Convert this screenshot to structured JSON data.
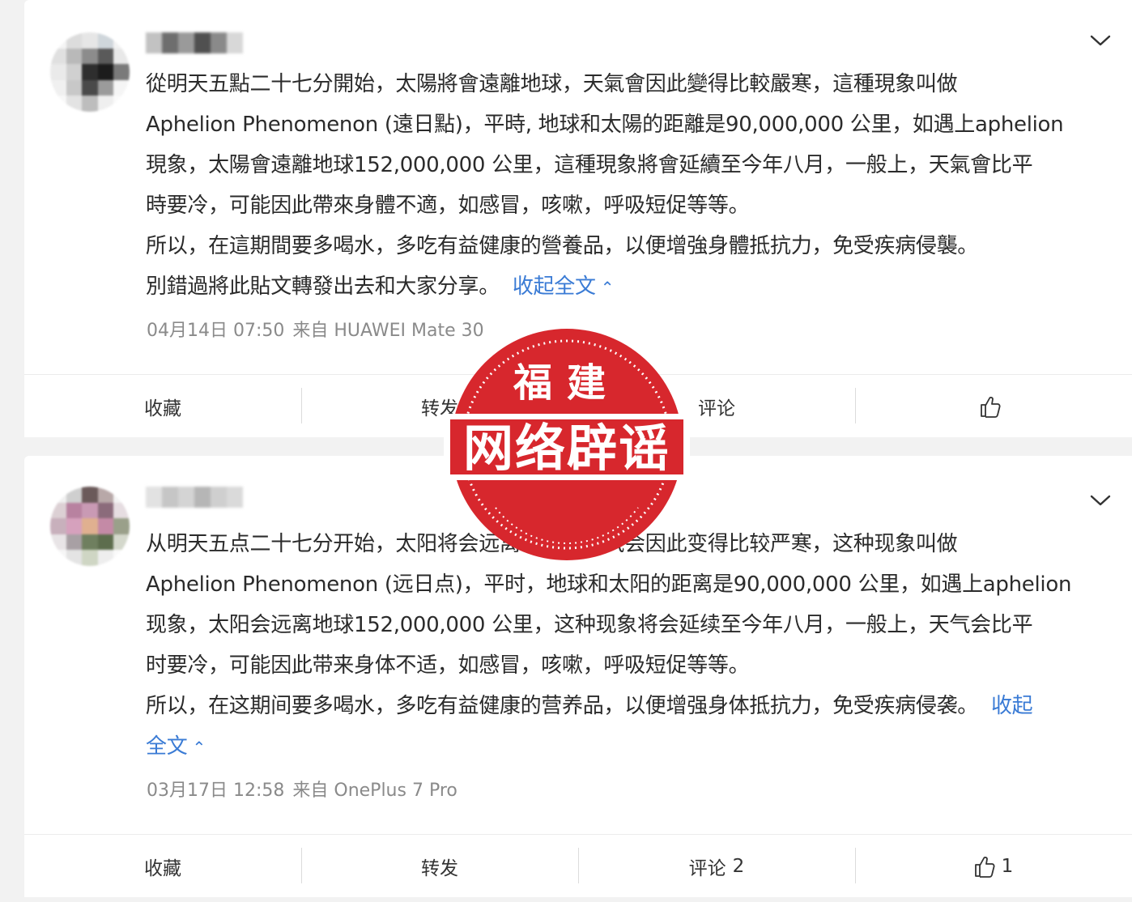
{
  "posts": [
    {
      "lines": [
        "從明天五點二十七分開始，太陽將會遠離地球，天氣會因此變得比較嚴寒，這種現象叫做",
        "Aphelion Phenomenon (遠日點)，平時, 地球和太陽的距離是90,000,000 公里，如遇上aphelion",
        "現象，太陽會遠離地球152,000,000 公里，這種現象將會延續至今年八月，一般上，天氣會比平",
        "時要冷，可能因此帶來身體不適，如感冒，咳嗽，呼吸短促等等。",
        "所以，在這期間要多喝水，多吃有益健康的營養品，以便增強身體抵抗力，免受疾病侵襲。"
      ],
      "last_line": "別錯過將此貼文轉發出去和大家分享。",
      "collapse_label": "收起全文",
      "time": "04月14日 07:50",
      "source": "来自 HUAWEI Mate 30",
      "actions": {
        "favorite": "收藏",
        "repost": "转发",
        "comment": "评论",
        "like_count": ""
      }
    },
    {
      "lines": [
        "从明天五点二十七分开始，太阳将会远离地球，天气会因此变得比较严寒，这种现象叫做",
        "Aphelion Phenomenon (远日点)，平时，地球和太阳的距离是90,000,000 公里，如遇上aphelion",
        "现象，太阳会远离地球152,000,000 公里，这种现象将会延续至今年八月，一般上，天气会比平",
        "时要冷，可能因此带来身体不适，如感冒，咳嗽，呼吸短促等等。"
      ],
      "last_line": "所以，在这期间要多喝水，多吃有益健康的营养品，以便增强身体抵抗力，免受疾病侵袭。",
      "collapse_label_part1": "收起",
      "collapse_label_part2": "全文",
      "time": "03月17日 12:58",
      "source": "来自 OnePlus 7 Pro",
      "actions": {
        "favorite": "收藏",
        "repost": "转发",
        "comment": "评论",
        "comment_count": "2",
        "like_count": "1"
      }
    }
  ],
  "stamp": {
    "top_text": "福建",
    "main_text": "网络辟谣"
  },
  "colors": {
    "link": "#3a7bd5",
    "stamp_red": "#d7272d",
    "page_bg": "#f2f2f2"
  },
  "icons": [
    "chevron-down-icon",
    "thumbs-up-icon",
    "caret-up-icon"
  ]
}
